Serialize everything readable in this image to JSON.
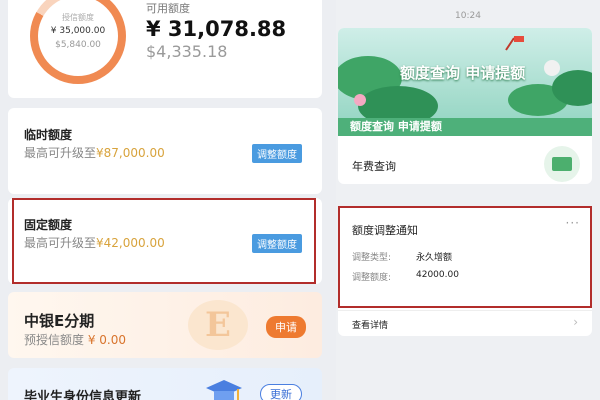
{
  "credit": {
    "ring_label": "授信额度",
    "ring_total": "¥ 35,000.00",
    "ring_used": "$5,840.00",
    "available_label": "可用额度",
    "available_amount": "¥ 31,078.88",
    "available_sub": "$4,335.18"
  },
  "temp_quota": {
    "title": "临时额度",
    "sub_prefix": "最高可升级至",
    "sub_amount": "¥87,000.00",
    "button": "调整额度"
  },
  "fixed_quota": {
    "title": "固定额度",
    "sub_prefix": "最高可升级至",
    "sub_amount": "¥42,000.00",
    "button": "调整额度"
  },
  "installment": {
    "title": "中银E分期",
    "sub_prefix": "预授信额度",
    "sub_amount": "¥ 0.00",
    "bg_letter": "E",
    "button": "申请"
  },
  "graduate": {
    "title": "毕业生身份信息更新",
    "button": "更新"
  },
  "right": {
    "time": "10:24",
    "banner_big_text": "额度查询 申请提额",
    "banner_text": "额度查询 申请提额",
    "fee_label": "年费查询",
    "notice": {
      "title": "额度调整通知",
      "more": "···",
      "rows": [
        {
          "label": "调整类型:",
          "value": "永久增额"
        },
        {
          "label": "调整额度:",
          "value": "42000.00"
        }
      ],
      "detail_link": "查看详情",
      "chevron": "›"
    }
  },
  "colors": {
    "accent_orange": "#f08a52",
    "button_blue": "#4a9be0",
    "highlight_red": "#b22d2b"
  }
}
